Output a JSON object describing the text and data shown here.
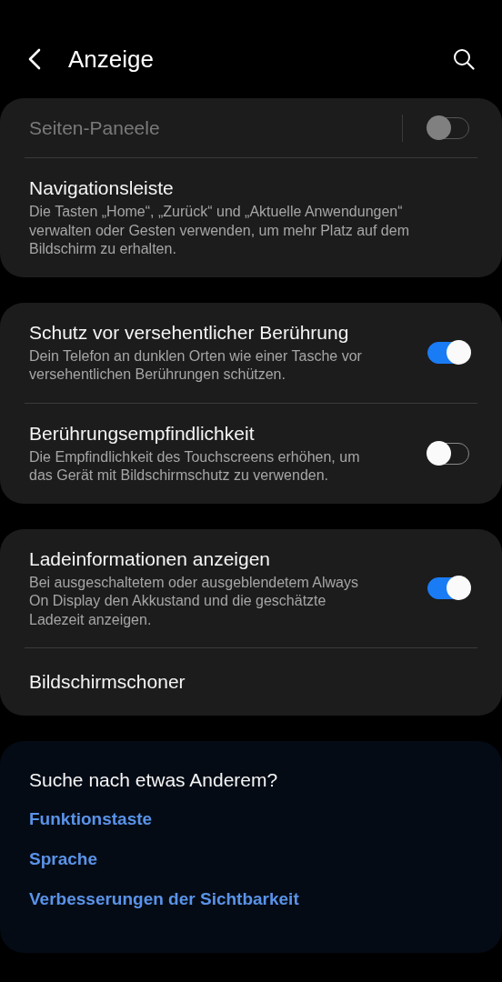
{
  "header": {
    "title": "Anzeige"
  },
  "groups": [
    {
      "items": [
        {
          "title": "Seiten-Paneele",
          "disabled": true,
          "switch": {
            "on": false,
            "separator": true
          }
        },
        {
          "title": "Navigationsleiste",
          "disabled": false,
          "description": "Die Tasten „Home“, „Zurück“ und „Aktuelle Anwendungen“ verwalten oder Gesten verwenden, um mehr Platz auf dem Bildschirm zu erhalten."
        }
      ]
    },
    {
      "items": [
        {
          "title": "Schutz vor versehentlicher Berührung",
          "disabled": false,
          "description": "Dein Telefon an dunklen Orten wie einer Tasche vor versehentlichen Berührungen schützen.",
          "switch": {
            "on": true,
            "separator": false
          }
        },
        {
          "title": "Berührungsempfindlichkeit",
          "disabled": false,
          "description": "Die Empfindlichkeit des Touchscreens erhöhen, um das Gerät mit Bildschirmschutz zu verwenden.",
          "switch": {
            "on": false,
            "separator": false
          }
        }
      ]
    },
    {
      "items": [
        {
          "title": "Ladeinformationen anzeigen",
          "disabled": false,
          "description": "Bei ausgeschaltetem oder ausgeblendetem Always On Display den Akkustand und die geschätzte Ladezeit anzeigen.",
          "switch": {
            "on": true,
            "separator": false
          }
        },
        {
          "title": "Bildschirmschoner",
          "disabled": false
        }
      ]
    }
  ],
  "suggestions": {
    "title": "Suche nach etwas Anderem?",
    "links": [
      "Funktionstaste",
      "Sprache",
      "Verbesserungen der Sichtbarkeit"
    ]
  }
}
